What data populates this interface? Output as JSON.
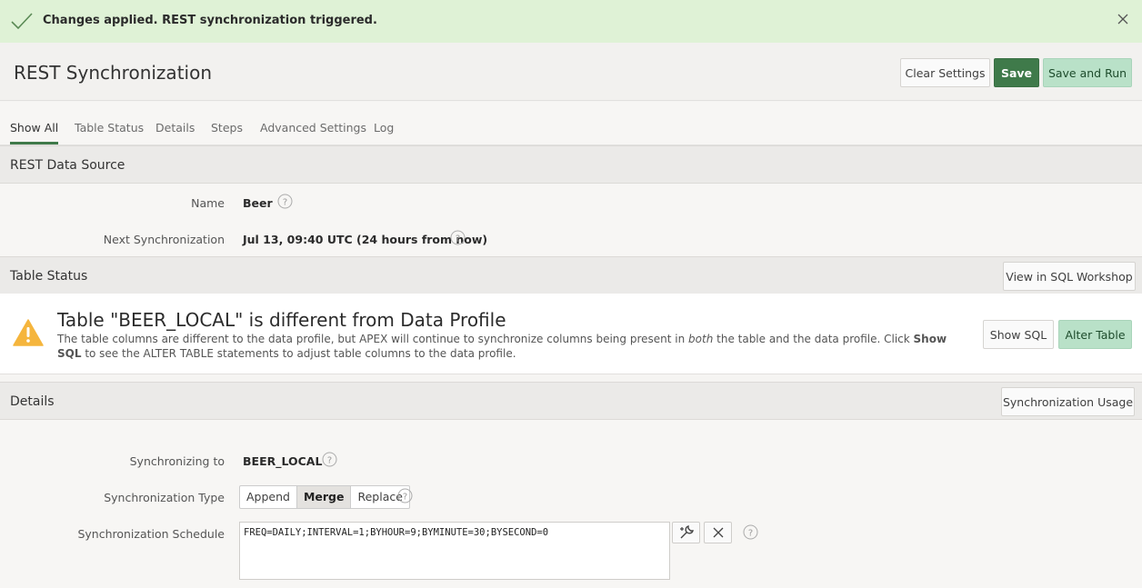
{
  "notification": {
    "message": "Changes applied. REST synchronization triggered."
  },
  "header": {
    "title": "REST Synchronization",
    "clear_label": "Clear Settings",
    "save_label": "Save",
    "save_run_label": "Save and Run"
  },
  "tabs": [
    {
      "label": "Show All",
      "active": true
    },
    {
      "label": "Table Status"
    },
    {
      "label": "Details"
    },
    {
      "label": "Steps"
    },
    {
      "label": "Advanced Settings"
    },
    {
      "label": "Log"
    }
  ],
  "rest_data_source": {
    "title": "REST Data Source",
    "name_label": "Name",
    "name_value": "Beer",
    "next_sync_label": "Next Synchronization",
    "next_sync_value": "Jul 13, 09:40 UTC (24 hours from now)"
  },
  "table_status": {
    "title": "Table Status",
    "sql_workshop_label": "View in SQL Workshop",
    "warning_title": "Table \"BEER_LOCAL\" is different from Data Profile",
    "warning_desc_1": "The table columns are different to the data profile, but APEX will continue to synchronize columns being present in ",
    "warning_desc_em": "both",
    "warning_desc_2": " the table and the data profile. Click ",
    "warning_desc_strong": "Show SQL",
    "warning_desc_3": " to see the ALTER TABLE statements to adjust table columns to the data profile.",
    "show_sql_label": "Show SQL",
    "alter_table_label": "Alter Table"
  },
  "details": {
    "title": "Details",
    "usage_label": "Synchronization Usage",
    "sync_to_label": "Synchronizing to",
    "sync_to_value": "BEER_LOCAL",
    "sync_type_label": "Synchronization Type",
    "sync_type_options": [
      "Append",
      "Merge",
      "Replace"
    ],
    "sync_type_selected": "Merge",
    "schedule_label": "Synchronization Schedule",
    "schedule_value": "FREQ=DAILY;INTERVAL=1;BYHOUR=9;BYMINUTE=30;BYSECOND=0"
  },
  "colors": {
    "accent": "#3f7a4a",
    "success_bg": "#dff2d6",
    "warning": "#f5b53d"
  },
  "icons": [
    "check-icon",
    "close-icon",
    "help-icon",
    "warning-icon",
    "wrench-icon",
    "clear-icon"
  ]
}
